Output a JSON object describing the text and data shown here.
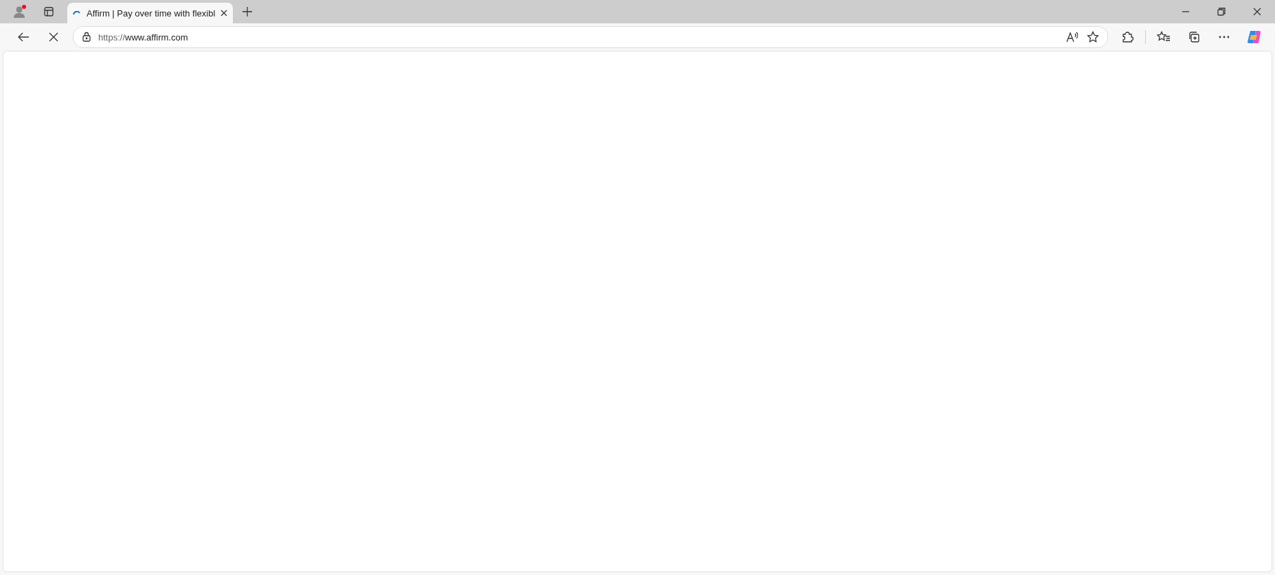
{
  "tabs": [
    {
      "title": "Affirm | Pay over time with flexibl",
      "selected": true,
      "loading": true
    }
  ],
  "address_bar": {
    "scheme": "https://",
    "host": "www.affirm.com"
  },
  "loading": true
}
